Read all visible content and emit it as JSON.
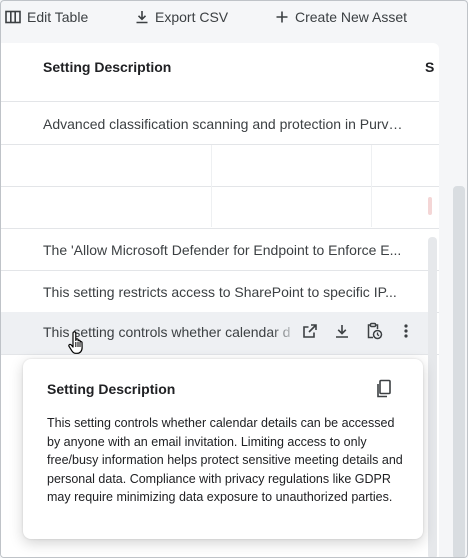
{
  "toolbar": {
    "edit_table_label": "Edit Table",
    "export_csv_label": "Export CSV",
    "create_asset_label": "Create New Asset"
  },
  "table": {
    "header": "Setting Description",
    "header_next_cut": "S",
    "rows": [
      {
        "text": "Advanced classification scanning and protection in Purview..."
      },
      {
        "text": ""
      },
      {
        "text": ""
      },
      {
        "text": "The 'Allow Microsoft Defender for Endpoint to Enforce E..."
      },
      {
        "text": "This setting restricts access to SharePoint to specific IP..."
      },
      {
        "text": "This setting controls whether calendar d"
      }
    ]
  },
  "popup": {
    "title": "Setting Description",
    "body": "This setting controls whether calendar details can be accessed by anyone with an email invitation. Limiting access to only free/busy information helps protect sensitive meeting details and personal data. Compliance with privacy regulations like GDPR may require minimizing data exposure to unauthorized parties."
  },
  "colors": {
    "background": "#f5f6f8",
    "panel": "#ffffff",
    "hover_row": "#eef0f3",
    "divider": "#e3e5e8",
    "text": "#202124",
    "muted_text": "#3c4043"
  },
  "icons": {
    "edit_table": "table-columns-icon",
    "export_csv": "download-icon",
    "create_asset": "plus-icon",
    "open": "open-external-icon",
    "download": "download-icon",
    "clipboard": "clipboard-clock-icon",
    "more": "more-vert-icon",
    "copy": "copy-icon",
    "cursor": "hand-pointer-icon"
  }
}
